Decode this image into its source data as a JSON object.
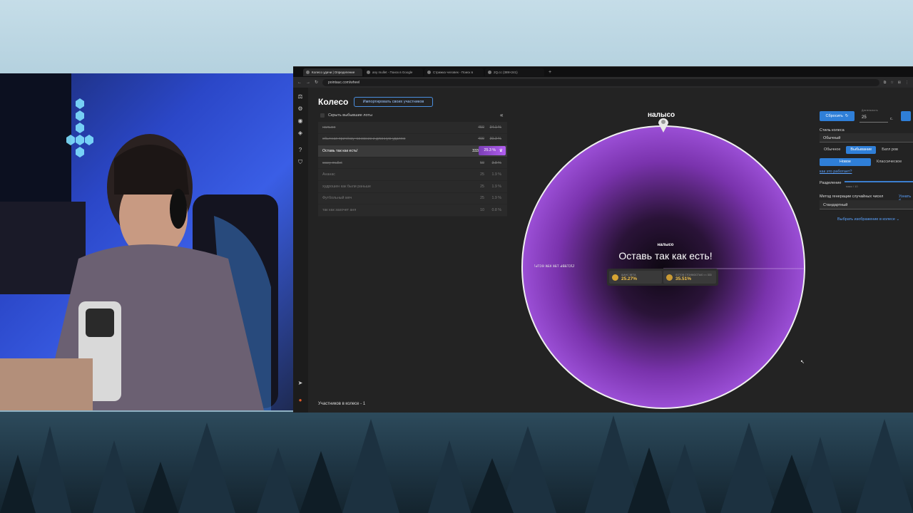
{
  "browser": {
    "tabs": [
      {
        "label": "Колесо удачи | Определение",
        "active": true
      },
      {
        "label": "any mullet - Поиск в Google",
        "active": false
      },
      {
        "label": "Стрижка человек - Поиск в",
        "active": false
      },
      {
        "label": "2Q.cc (389×241)",
        "active": false
      }
    ],
    "new_tab": "+",
    "url": "pointauc.com/wheel"
  },
  "app": {
    "title": "Колесо",
    "import_button": "Импортировать своих участников",
    "hide_dropped_label": "Скрыть выбывшие лоты",
    "collapse_icon": "«",
    "lots": [
      {
        "name": "налысо",
        "amount": "450",
        "percent": "34.1 %",
        "struck": true,
        "active": false
      },
      {
        "name": "обычная причёску чиновник и длинную удаляю",
        "amount": "400",
        "percent": "30.3 %",
        "struck": true,
        "active": false
      },
      {
        "name": "Оставь так как есть!",
        "amount": "333",
        "percent": "25.3 %",
        "struck": false,
        "active": true
      },
      {
        "name": "wavy mullet",
        "amount": "50",
        "percent": "3.8 %",
        "struck": true,
        "active": false
      },
      {
        "name": "Ананас",
        "amount": "25",
        "percent": "1.9 %",
        "struck": false,
        "active": false
      },
      {
        "name": "худрошен как были раньше",
        "amount": "25",
        "percent": "1.9 %",
        "struck": false,
        "active": false
      },
      {
        "name": "Футбольный мяч",
        "amount": "25",
        "percent": "1.9 %",
        "struck": false,
        "active": false
      },
      {
        "name": "так как захочет аня",
        "amount": "10",
        "percent": "0.8 %",
        "struck": false,
        "active": false
      }
    ],
    "participants_count": "Участников в колесе - 1"
  },
  "wheel": {
    "pointer_label": "налысо",
    "center_small": "налысо",
    "center_winner": "Оставь так как есть!",
    "mirrored_label": "Оставь так как есть!",
    "stat1_label": "ШАНС ВЕТА",
    "stat1_value": "25.27%",
    "stat2_label": "ЛОТОВ СТОИМОСТЬЮ >= 333",
    "stat2_value": "35.51%",
    "color_main": "#8e3ec7",
    "color_dark": "#140a1c"
  },
  "settings": {
    "reset_button": "Сбросить",
    "duration_label": "Длительность",
    "duration_value": "25",
    "duration_unit": "с.",
    "wheel_style_label": "Стиль колеса",
    "wheel_style_value": "Обычный",
    "mode_tabs": [
      "Обычное",
      "Выбывание",
      "Батл ров"
    ],
    "mode_selected": "Выбывание",
    "variant_tabs": [
      "Новое",
      "Классическое"
    ],
    "variant_selected": "Новое",
    "how_it_works": "как это работает?",
    "split_label": "Разделение",
    "split_hint": "макс / 10",
    "rng_label": "Метод генерации случайных чисел",
    "rng_more": "Узнать б",
    "rng_value": "Стандартный",
    "choose_image": "Выбрать изображение в колесе"
  }
}
